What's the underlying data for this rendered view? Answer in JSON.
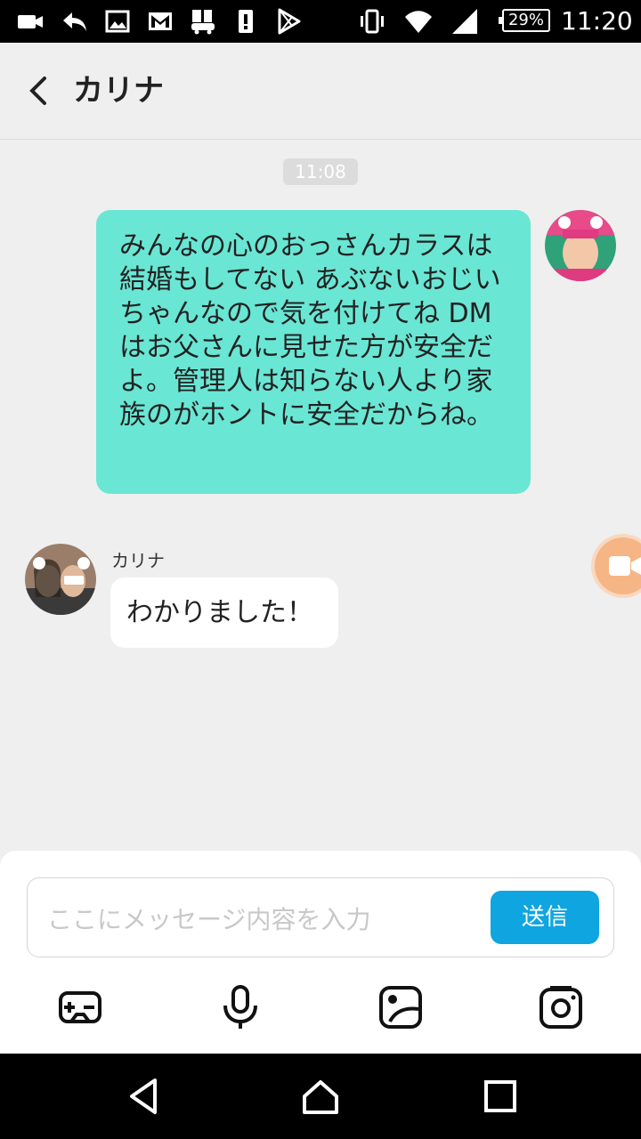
{
  "status_bar": {
    "battery": "29%",
    "time": "11:20",
    "left_icons": [
      "video-icon",
      "reply-icon",
      "image-icon",
      "gmail-icon",
      "calendar-icon",
      "alert-icon",
      "play-store-icon"
    ],
    "right_icons": [
      "vibrate-icon",
      "wifi-icon",
      "signal-icon"
    ]
  },
  "header": {
    "title": "カリナ"
  },
  "chat": {
    "timestamp": "11:08",
    "outgoing_message": "みんなの心のおっさんカラスは結婚もしてない あぶないおじいちゃんなので気を付けてね DMはお父さんに見せた方が安全だよ。管理人は知らない人より家族のがホントに安全だからね。",
    "incoming_sender": "カリナ",
    "incoming_message": "わかりました！"
  },
  "composer": {
    "placeholder": "ここにメッセージ内容を入力",
    "value": "",
    "send_label": "送信",
    "tools": [
      "gamepad-icon",
      "microphone-icon",
      "sticker-icon",
      "camera-icon"
    ]
  },
  "colors": {
    "outgoing_bubble": "#6ae6d4",
    "send_button": "#0fa5e0",
    "video_fab": "#f6b585"
  }
}
